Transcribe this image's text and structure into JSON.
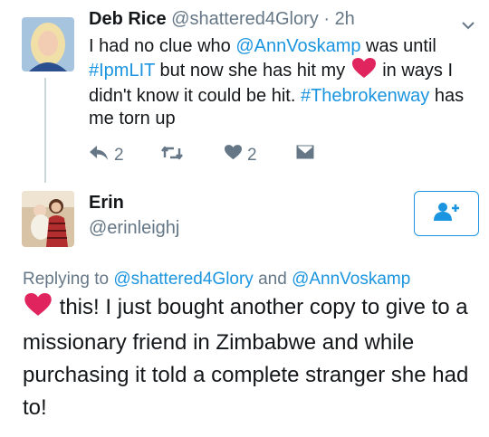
{
  "tweet1": {
    "display_name": "Deb Rice",
    "handle": "@shattered4Glory",
    "separator": "·",
    "time": "2h",
    "text_1": "I had no clue who ",
    "mention": "@AnnVoskamp",
    "text_2": " was until ",
    "hashtag_1": "#IpmLIT",
    "text_3": " but now she has hit my ",
    "text_4": " in ways I didn't know it could be hit. ",
    "hashtag_2": "#Thebrokenway",
    "text_5": " has me torn up",
    "reply_count": "2",
    "like_count": "2",
    "menu_icon": "chevron-down-icon"
  },
  "tweet2": {
    "display_name": "Erin",
    "handle": "@erinleighj",
    "follow_icon": "add-user-icon",
    "replying_prefix": "Replying to ",
    "replying_user_1": "@shattered4Glory",
    "replying_and": " and ",
    "replying_user_2": "@AnnVoskamp",
    "text": " this! I just bought another copy to give to a missionary friend in Zimbabwe and while purchasing it told a complete stranger she had to!"
  },
  "colors": {
    "link": "#1b95e0",
    "heart": "#e0245e",
    "muted": "#657786",
    "text": "#14171a",
    "thread_line": "#ccd6dd"
  }
}
